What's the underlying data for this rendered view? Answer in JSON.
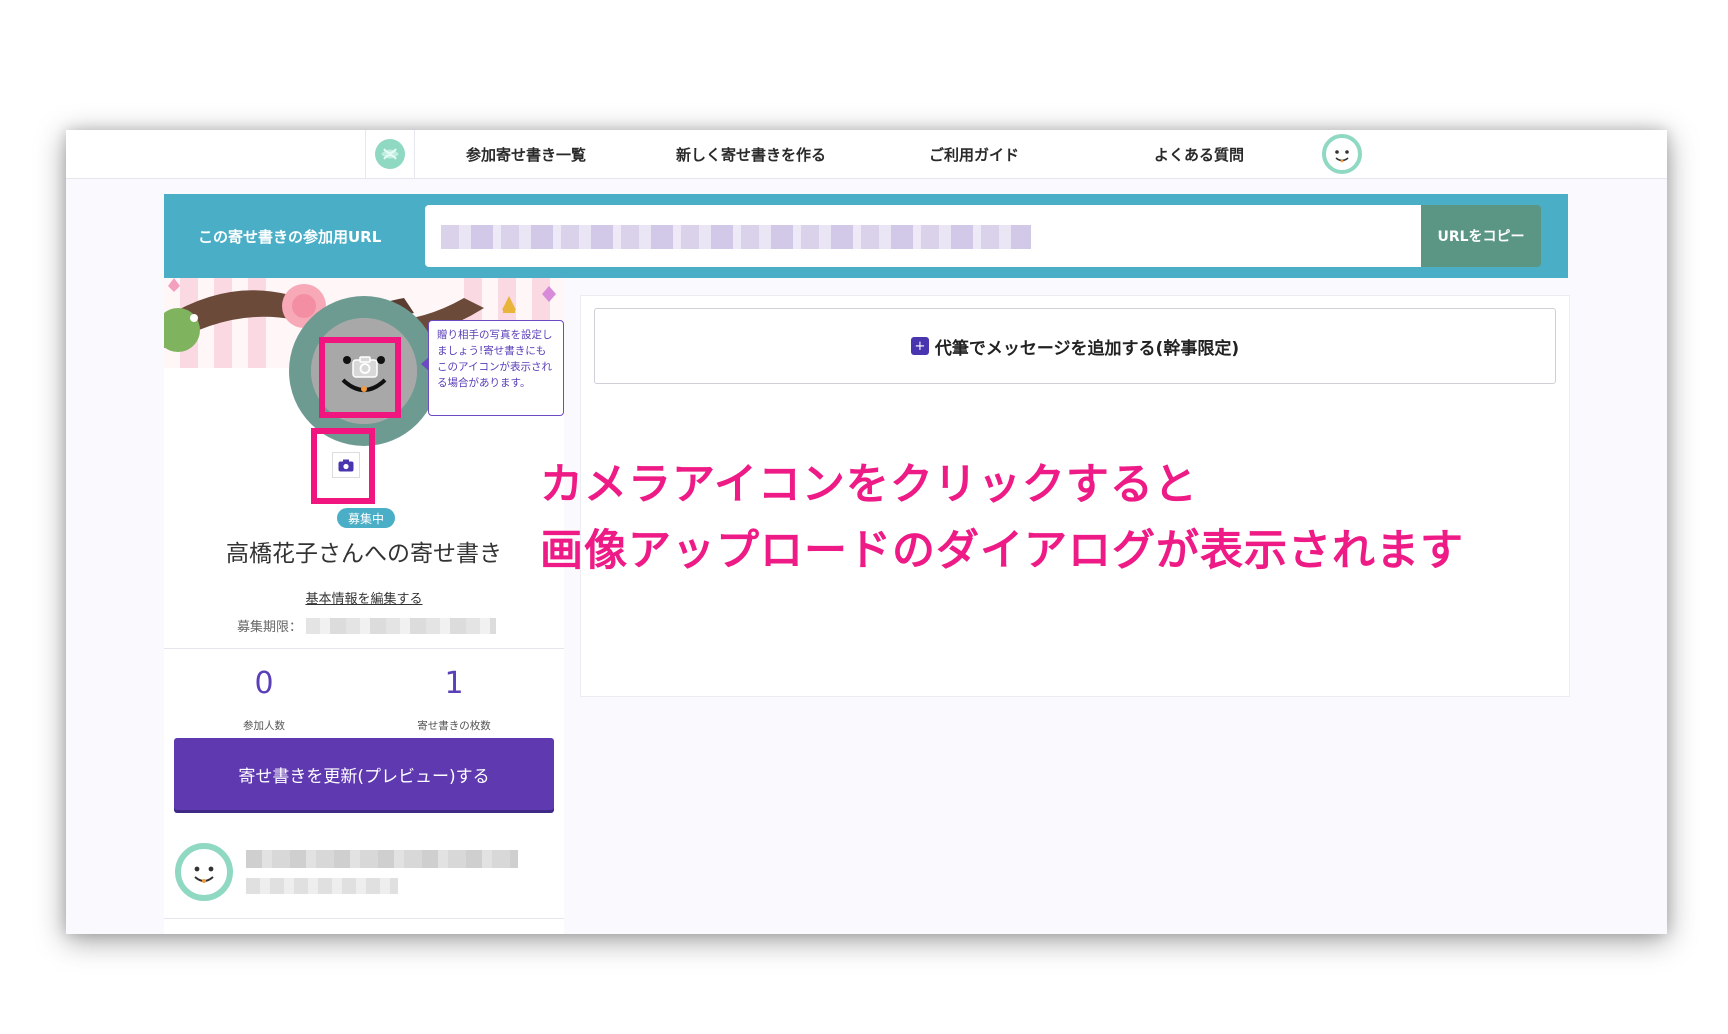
{
  "nav": {
    "items": [
      "参加寄せ書き一覧",
      "新しく寄せ書きを作る",
      "ご利用ガイド",
      "よくある質問"
    ]
  },
  "urlbar": {
    "label": "この寄せ書きの参加用URL",
    "copy_button": "URLをコピー"
  },
  "profile": {
    "tooltip": "贈り相手の写真を設定しましょう!寄せ書きにもこのアイコンが表示される場合があります。",
    "status_badge": "募集中",
    "title": "高橋花子さんへの寄せ書き",
    "edit_link": "基本情報を編集する",
    "deadline_label": "募集期限："
  },
  "stats": [
    {
      "value": "0",
      "label": "参加人数"
    },
    {
      "value": "1",
      "label": "寄せ書きの枚数"
    }
  ],
  "actions": {
    "update_button": "寄せ書きを更新(プレビュー)する",
    "add_message_button": "代筆でメッセージを追加する(幹事限定)",
    "add_icon_glyph": "+"
  },
  "annotation": {
    "line1": "カメラアイコンをクリックすると",
    "line2": "画像アップロードのダイアログが表示されます"
  },
  "colors": {
    "accent_purple": "#5f39b0",
    "url_bar_teal": "#4aaec6",
    "copy_green": "#5a9683",
    "highlight_pink": "#f0157f"
  },
  "icons": [
    "logo-icon",
    "user-avatar-icon",
    "camera-icon",
    "plus-icon"
  ]
}
